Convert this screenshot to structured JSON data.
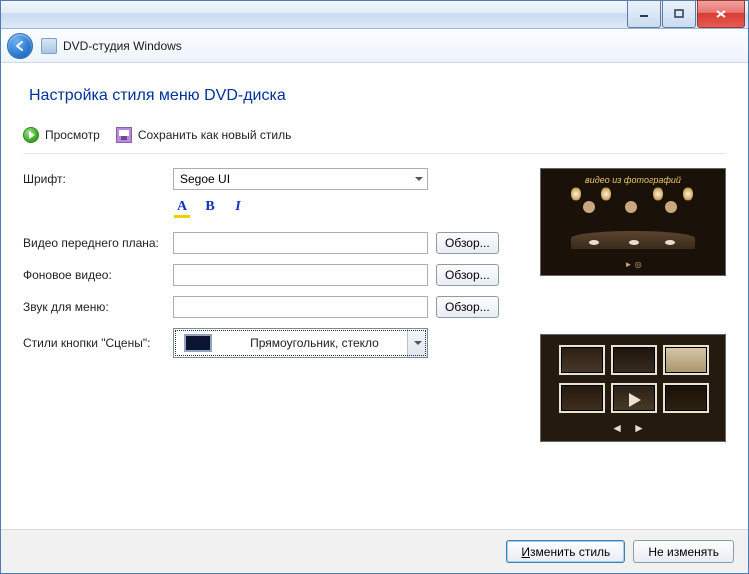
{
  "window": {
    "app_title": "DVD-студия Windows"
  },
  "heading": "Настройка стиля меню DVD-диска",
  "toolbar": {
    "preview_label": "Просмотр",
    "save_label": "Сохранить как новый стиль"
  },
  "form": {
    "font_label": "Шрифт:",
    "font_value": "Segoe UI",
    "foreground_video_label": "Видео переднего плана:",
    "foreground_video_value": "",
    "background_video_label": "Фоновое видео:",
    "background_video_value": "",
    "menu_audio_label": "Звук для меню:",
    "menu_audio_value": "",
    "browse_label": "Обзор...",
    "scene_style_label": "Стили кнопки \"Сцены\":",
    "scene_style_value": "Прямоугольник, стекло"
  },
  "preview": {
    "main_overlay": "видео из фотографий",
    "main_play": "► ◎"
  },
  "footer": {
    "apply_prefix": "И",
    "apply_rest": "зменить стиль",
    "cancel": "Не изменять"
  }
}
